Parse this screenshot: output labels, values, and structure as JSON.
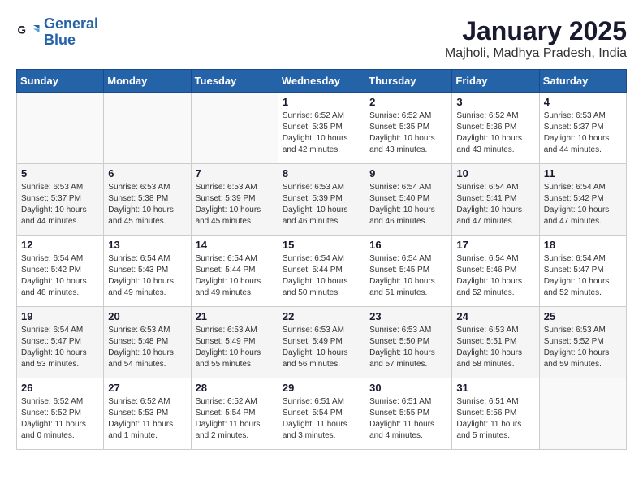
{
  "header": {
    "logo_line1": "General",
    "logo_line2": "Blue",
    "month_year": "January 2025",
    "location": "Majholi, Madhya Pradesh, India"
  },
  "days_of_week": [
    "Sunday",
    "Monday",
    "Tuesday",
    "Wednesday",
    "Thursday",
    "Friday",
    "Saturday"
  ],
  "weeks": [
    [
      {
        "day": "",
        "info": ""
      },
      {
        "day": "",
        "info": ""
      },
      {
        "day": "",
        "info": ""
      },
      {
        "day": "1",
        "info": "Sunrise: 6:52 AM\nSunset: 5:35 PM\nDaylight: 10 hours\nand 42 minutes."
      },
      {
        "day": "2",
        "info": "Sunrise: 6:52 AM\nSunset: 5:35 PM\nDaylight: 10 hours\nand 43 minutes."
      },
      {
        "day": "3",
        "info": "Sunrise: 6:52 AM\nSunset: 5:36 PM\nDaylight: 10 hours\nand 43 minutes."
      },
      {
        "day": "4",
        "info": "Sunrise: 6:53 AM\nSunset: 5:37 PM\nDaylight: 10 hours\nand 44 minutes."
      }
    ],
    [
      {
        "day": "5",
        "info": "Sunrise: 6:53 AM\nSunset: 5:37 PM\nDaylight: 10 hours\nand 44 minutes."
      },
      {
        "day": "6",
        "info": "Sunrise: 6:53 AM\nSunset: 5:38 PM\nDaylight: 10 hours\nand 45 minutes."
      },
      {
        "day": "7",
        "info": "Sunrise: 6:53 AM\nSunset: 5:39 PM\nDaylight: 10 hours\nand 45 minutes."
      },
      {
        "day": "8",
        "info": "Sunrise: 6:53 AM\nSunset: 5:39 PM\nDaylight: 10 hours\nand 46 minutes."
      },
      {
        "day": "9",
        "info": "Sunrise: 6:54 AM\nSunset: 5:40 PM\nDaylight: 10 hours\nand 46 minutes."
      },
      {
        "day": "10",
        "info": "Sunrise: 6:54 AM\nSunset: 5:41 PM\nDaylight: 10 hours\nand 47 minutes."
      },
      {
        "day": "11",
        "info": "Sunrise: 6:54 AM\nSunset: 5:42 PM\nDaylight: 10 hours\nand 47 minutes."
      }
    ],
    [
      {
        "day": "12",
        "info": "Sunrise: 6:54 AM\nSunset: 5:42 PM\nDaylight: 10 hours\nand 48 minutes."
      },
      {
        "day": "13",
        "info": "Sunrise: 6:54 AM\nSunset: 5:43 PM\nDaylight: 10 hours\nand 49 minutes."
      },
      {
        "day": "14",
        "info": "Sunrise: 6:54 AM\nSunset: 5:44 PM\nDaylight: 10 hours\nand 49 minutes."
      },
      {
        "day": "15",
        "info": "Sunrise: 6:54 AM\nSunset: 5:44 PM\nDaylight: 10 hours\nand 50 minutes."
      },
      {
        "day": "16",
        "info": "Sunrise: 6:54 AM\nSunset: 5:45 PM\nDaylight: 10 hours\nand 51 minutes."
      },
      {
        "day": "17",
        "info": "Sunrise: 6:54 AM\nSunset: 5:46 PM\nDaylight: 10 hours\nand 52 minutes."
      },
      {
        "day": "18",
        "info": "Sunrise: 6:54 AM\nSunset: 5:47 PM\nDaylight: 10 hours\nand 52 minutes."
      }
    ],
    [
      {
        "day": "19",
        "info": "Sunrise: 6:54 AM\nSunset: 5:47 PM\nDaylight: 10 hours\nand 53 minutes."
      },
      {
        "day": "20",
        "info": "Sunrise: 6:53 AM\nSunset: 5:48 PM\nDaylight: 10 hours\nand 54 minutes."
      },
      {
        "day": "21",
        "info": "Sunrise: 6:53 AM\nSunset: 5:49 PM\nDaylight: 10 hours\nand 55 minutes."
      },
      {
        "day": "22",
        "info": "Sunrise: 6:53 AM\nSunset: 5:49 PM\nDaylight: 10 hours\nand 56 minutes."
      },
      {
        "day": "23",
        "info": "Sunrise: 6:53 AM\nSunset: 5:50 PM\nDaylight: 10 hours\nand 57 minutes."
      },
      {
        "day": "24",
        "info": "Sunrise: 6:53 AM\nSunset: 5:51 PM\nDaylight: 10 hours\nand 58 minutes."
      },
      {
        "day": "25",
        "info": "Sunrise: 6:53 AM\nSunset: 5:52 PM\nDaylight: 10 hours\nand 59 minutes."
      }
    ],
    [
      {
        "day": "26",
        "info": "Sunrise: 6:52 AM\nSunset: 5:52 PM\nDaylight: 11 hours\nand 0 minutes."
      },
      {
        "day": "27",
        "info": "Sunrise: 6:52 AM\nSunset: 5:53 PM\nDaylight: 11 hours\nand 1 minute."
      },
      {
        "day": "28",
        "info": "Sunrise: 6:52 AM\nSunset: 5:54 PM\nDaylight: 11 hours\nand 2 minutes."
      },
      {
        "day": "29",
        "info": "Sunrise: 6:51 AM\nSunset: 5:54 PM\nDaylight: 11 hours\nand 3 minutes."
      },
      {
        "day": "30",
        "info": "Sunrise: 6:51 AM\nSunset: 5:55 PM\nDaylight: 11 hours\nand 4 minutes."
      },
      {
        "day": "31",
        "info": "Sunrise: 6:51 AM\nSunset: 5:56 PM\nDaylight: 11 hours\nand 5 minutes."
      },
      {
        "day": "",
        "info": ""
      }
    ]
  ]
}
